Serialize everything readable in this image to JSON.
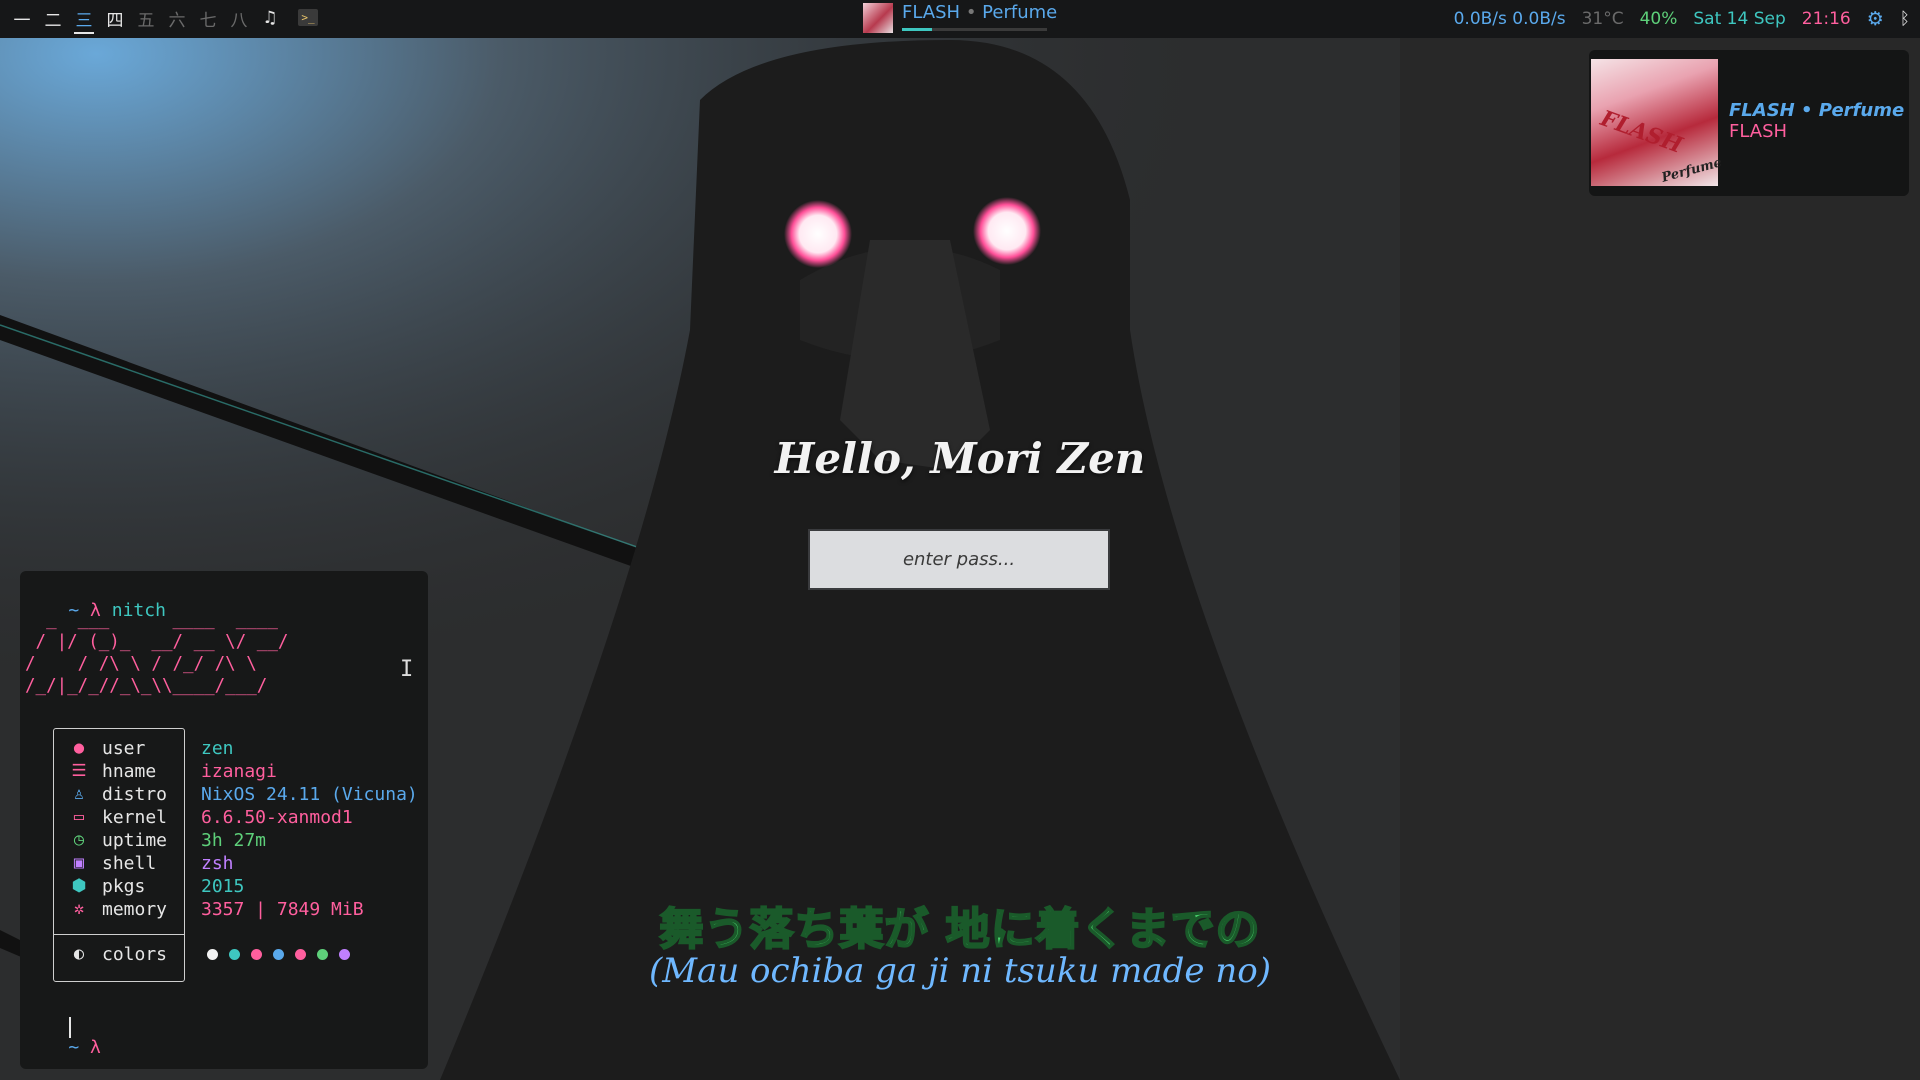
{
  "topbar": {
    "workspaces": [
      {
        "label": "一",
        "state": "normal"
      },
      {
        "label": "二",
        "state": "normal"
      },
      {
        "label": "三",
        "state": "active"
      },
      {
        "label": "四",
        "state": "normal"
      },
      {
        "label": "五",
        "state": "dim"
      },
      {
        "label": "六",
        "state": "dim"
      },
      {
        "label": "七",
        "state": "dim"
      },
      {
        "label": "八",
        "state": "dim"
      },
      {
        "label": "♫",
        "state": "normal"
      }
    ],
    "terminal_ws_icon": "terminal-icon",
    "now_playing": {
      "track": "FLASH",
      "separator": "•",
      "artist": "Perfume",
      "progress_percent": 21
    },
    "status": {
      "network": "0.0B/s 0.0B/s",
      "temperature": "31°C",
      "battery": "40%",
      "date": "Sat 14 Sep",
      "time": "21:16",
      "settings_icon": "gear-icon",
      "bluetooth_icon": "bluetooth-icon"
    }
  },
  "notification": {
    "title": "FLASH • Perfume",
    "body": "FLASH",
    "art_text_1": "FLASH",
    "art_text_2": "Perfume"
  },
  "login": {
    "greeting": "Hello, Mori Zen",
    "password_placeholder": "enter pass..."
  },
  "lyrics": {
    "japanese": "舞う落ち葉が 地に着くまでの",
    "romaji": "(Mau ochiba ga ji ni tsuku made no)"
  },
  "terminal": {
    "prompt_tilde": "~",
    "prompt_lambda": "λ",
    "command": "nitch",
    "ascii_art": "  _  ___      ____  ____\n / |/ (_)_  __/ __ \\/ __/\n/    / /\\ \\ / /_/ /\\ \\\n/_/|_/_//_\\_\\\\____/___/",
    "info": [
      {
        "icon": "user-icon",
        "label": "user",
        "value": "zen",
        "color": "#3ec7c0"
      },
      {
        "icon": "hostname-icon",
        "label": "hname",
        "value": "izanagi",
        "color": "#ff5f9e"
      },
      {
        "icon": "linux-icon",
        "label": "distro",
        "value": "NixOS 24.11 (Vicuna)",
        "color": "#5aa9ec"
      },
      {
        "icon": "laptop-icon",
        "label": "kernel",
        "value": "6.6.50-xanmod1",
        "color": "#ff5f9e"
      },
      {
        "icon": "clock-icon",
        "label": "uptime",
        "value": "3h 27m",
        "color": "#5ed07a"
      },
      {
        "icon": "terminal-icon",
        "label": "shell",
        "value": "zsh",
        "color": "#c080ff"
      },
      {
        "icon": "package-icon",
        "label": "pkgs",
        "value": "2015",
        "color": "#3ec7c0"
      },
      {
        "icon": "chip-icon",
        "label": "memory",
        "value": "3357 | 7849 MiB",
        "color": "#ff5f9e"
      }
    ],
    "colors_label": "colors",
    "palette": [
      "#f2f2f2",
      "#3ec7c0",
      "#ff5f9e",
      "#5aa9ec",
      "#ff5f9e",
      "#5ed07a",
      "#c080ff"
    ]
  }
}
